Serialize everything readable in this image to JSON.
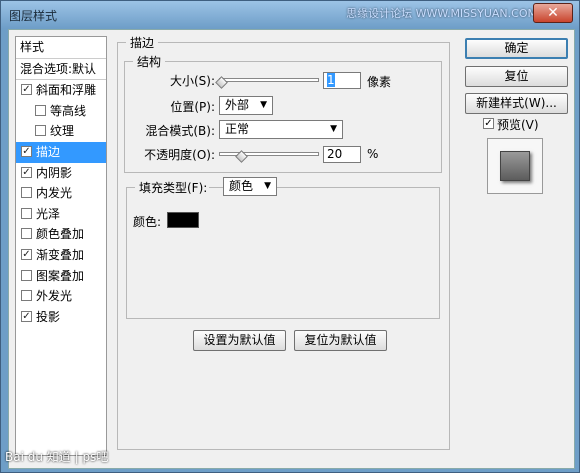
{
  "window": {
    "title": "图层样式",
    "close": "✕",
    "watermark": "思缘设计论坛 WWW.MISSYUAN.COM"
  },
  "style_list": {
    "header": "样式",
    "blend_options": "混合选项:默认",
    "items": [
      {
        "label": "斜面和浮雕",
        "checked": true,
        "level": 1
      },
      {
        "label": "等高线",
        "checked": false,
        "level": 2
      },
      {
        "label": "纹理",
        "checked": false,
        "level": 2
      },
      {
        "label": "描边",
        "checked": true,
        "level": 1,
        "selected": true
      },
      {
        "label": "内阴影",
        "checked": true,
        "level": 1
      },
      {
        "label": "内发光",
        "checked": false,
        "level": 1
      },
      {
        "label": "光泽",
        "checked": false,
        "level": 1
      },
      {
        "label": "颜色叠加",
        "checked": false,
        "level": 1
      },
      {
        "label": "渐变叠加",
        "checked": true,
        "level": 1
      },
      {
        "label": "图案叠加",
        "checked": false,
        "level": 1
      },
      {
        "label": "外发光",
        "checked": false,
        "level": 1
      },
      {
        "label": "投影",
        "checked": true,
        "level": 1
      }
    ]
  },
  "stroke": {
    "section_title": "描边",
    "structure_title": "结构",
    "size_label": "大小(S):",
    "size_value": "1",
    "size_unit": "像素",
    "position_label": "位置(P):",
    "position_value": "外部",
    "blend_label": "混合模式(B):",
    "blend_value": "正常",
    "opacity_label": "不透明度(O):",
    "opacity_value": "20",
    "opacity_unit": "%",
    "opacity_fraction": 0.2,
    "size_fraction": 0.0,
    "fill_type_label": "填充类型(F):",
    "fill_type_value": "颜色",
    "color_label": "颜色:",
    "color_hex": "#000000",
    "set_default": "设置为默认值",
    "reset_default": "复位为默认值"
  },
  "buttons": {
    "ok": "确定",
    "reset": "复位",
    "new_style": "新建样式(W)...",
    "preview": "预览(V)",
    "preview_checked": true
  },
  "footer": {
    "baidu_text": "Bai du 知道 | ps吧"
  }
}
